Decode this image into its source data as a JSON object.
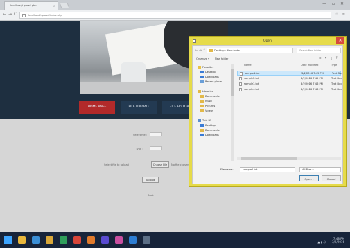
{
  "browser": {
    "tab_title": "localhost/upload.php",
    "tab_close": "×",
    "window_controls": "— ▫ ✕",
    "back": "←",
    "forward": "→",
    "reload": "C",
    "url": "localhost/upload/index.php",
    "toolbar_icons": "☆ ≡"
  },
  "page": {
    "nav_buttons": [
      "HOME PAGE",
      "FILE UPLOAD",
      "FILE HISTORY"
    ],
    "form": {
      "name_label": "Select file : ",
      "name_placeholder": "",
      "type_label": "Type :",
      "file_label": "Select file to upload :",
      "browse_label": "Choose File",
      "no_file_text": "No file chosen",
      "upload_label": "Upload",
      "footer_text": "Back"
    }
  },
  "dialog": {
    "title": "Open",
    "close": "✕",
    "nav_arrows": "← → ↑",
    "path": "Desktop › New folder",
    "search_placeholder": "Search New folder",
    "organize_label": "Organize ▾",
    "new_folder_label": "New folder",
    "view_icons": "≡ ▾ ▯ ?",
    "sidebar": [
      {
        "label": "Favorites",
        "color": "#e8c34a"
      },
      {
        "label": "Desktop",
        "color": "#3a7bd5"
      },
      {
        "label": "Downloads",
        "color": "#3a7bd5"
      },
      {
        "label": "Recent places",
        "color": "#6a9fd8"
      },
      {
        "label": "Libraries",
        "color": "#e2b94a"
      },
      {
        "label": "Documents",
        "color": "#e2b94a"
      },
      {
        "label": "Music",
        "color": "#e2b94a"
      },
      {
        "label": "Pictures",
        "color": "#e2b94a"
      },
      {
        "label": "Videos",
        "color": "#e2b94a"
      },
      {
        "label": "This PC",
        "color": "#5b8fd0"
      },
      {
        "label": "Desktop",
        "color": "#3a7bd5"
      },
      {
        "label": "Documents",
        "color": "#e2b94a"
      },
      {
        "label": "Downloads",
        "color": "#3a7bd5"
      }
    ],
    "columns": {
      "name": "Name",
      "date": "Date modified",
      "type": "Type"
    },
    "files": [
      {
        "name": "sample1.txt",
        "date": "3/2/2016 7:45 PM",
        "type": "Text Doc",
        "selected": true
      },
      {
        "name": "sample2.txt",
        "date": "3/2/2016 7:45 PM",
        "type": "Text Doc",
        "selected": false
      },
      {
        "name": "sample3.txt",
        "date": "3/2/2016 7:46 PM",
        "type": "Text Doc",
        "selected": false
      },
      {
        "name": "sample4.txt",
        "date": "3/2/2016 7:46 PM",
        "type": "Text Doc",
        "selected": false
      }
    ],
    "filename_label": "File name:",
    "filename_value": "sample1.txt",
    "filetype_value": "All Files ▾",
    "open_label": "Open ▾",
    "cancel_label": "Cancel"
  },
  "taskbar": {
    "tray_icons": "▲ ▮ ◂) ",
    "time": "7:48 PM",
    "date": "3/2/2016",
    "apps": [
      {
        "name": "explorer-icon",
        "color": "#e8b73c"
      },
      {
        "name": "ie-icon",
        "color": "#3b8fd6"
      },
      {
        "name": "files-icon",
        "color": "#d9a83a"
      },
      {
        "name": "store-icon",
        "color": "#2f9e5b"
      },
      {
        "name": "chrome-icon",
        "color": "#d8463a"
      },
      {
        "name": "firefox-icon",
        "color": "#e07a2c"
      },
      {
        "name": "app-icon",
        "color": "#5a4bd1"
      },
      {
        "name": "paint-icon",
        "color": "#c94fa0"
      },
      {
        "name": "vs-icon",
        "color": "#2d7dd2"
      },
      {
        "name": "folder-icon",
        "color": "#5c6f86"
      }
    ]
  }
}
